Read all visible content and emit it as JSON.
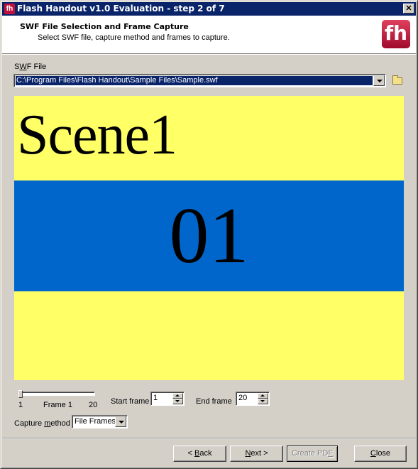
{
  "window": {
    "title": "Flash Handout v1.0 Evaluation - step 2 of 7",
    "close_glyph": "✕",
    "app_icon_text": "fh"
  },
  "header": {
    "title": "SWF File Selection and Frame Capture",
    "subtitle": "Select SWF file, capture method and frames to capture.",
    "logo_text": "fh",
    "logo_color": "#c0123c"
  },
  "swf_file": {
    "label_prefix": "S",
    "label_underlined": "W",
    "label_suffix": "F File",
    "value": "C:\\Program Files\\Flash Handout\\Sample Files\\Sample.swf",
    "browse_icon": "folder-icon"
  },
  "preview": {
    "scene_text": "Scene1",
    "frame_text": "01",
    "background_color": "#ffff66",
    "band_color": "#0066cc"
  },
  "frame_slider": {
    "min_label": "1",
    "max_label": "20",
    "current_label": "Frame 1",
    "min": 1,
    "max": 20,
    "value": 1
  },
  "start_frame": {
    "label": "Start frame",
    "value": "1"
  },
  "end_frame": {
    "label": "End frame",
    "value": "20"
  },
  "capture_method": {
    "label_prefix": "Capture ",
    "label_underlined": "m",
    "label_suffix": "ethod",
    "selected": "File Frames"
  },
  "buttons": {
    "back": {
      "prefix": "< ",
      "underlined": "B",
      "suffix": "ack"
    },
    "next": {
      "prefix": "",
      "underlined": "N",
      "suffix": "ext >"
    },
    "create_pdf": {
      "prefix": "Create PD",
      "underlined": "F",
      "suffix": "",
      "disabled": true
    },
    "close": {
      "prefix": "",
      "underlined": "C",
      "suffix": "lose"
    }
  }
}
